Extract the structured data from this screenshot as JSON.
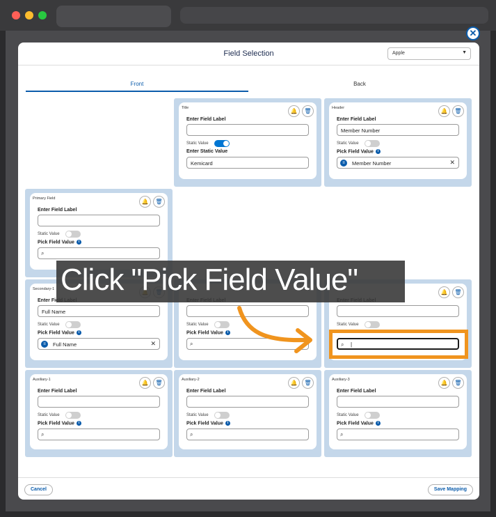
{
  "modal": {
    "title": "Field Selection",
    "platform_select": "Apple",
    "tabs": [
      "Front",
      "Back"
    ]
  },
  "labels": {
    "enter_field_label": "Enter Field Label",
    "static_value": "Static Value",
    "enter_static_value": "Enter Static Value",
    "pick_field_value": "Pick Field Value"
  },
  "cards": {
    "title": {
      "name": "Title",
      "static_value": "Kemicard"
    },
    "header": {
      "name": "Header",
      "field_label": "Member Number",
      "picked_value": "Member Number"
    },
    "primary": {
      "name": "Primary Field"
    },
    "secondary1": {
      "name": "Secondary-1",
      "field_label": "Full Name",
      "picked_value": "Full Name"
    },
    "auxiliary1": {
      "name": "Auxiliary-1"
    },
    "auxiliary2": {
      "name": "Auxiliary-2"
    },
    "auxiliary3": {
      "name": "Auxiliary-3"
    }
  },
  "footer": {
    "cancel": "Cancel",
    "save": "Save Mapping"
  },
  "overlay": {
    "instruction": "Click \"Pick Field Value\""
  },
  "colors": {
    "accent": "#0b5cab",
    "panel": "#c4d7ea",
    "highlight": "#f0941e"
  }
}
